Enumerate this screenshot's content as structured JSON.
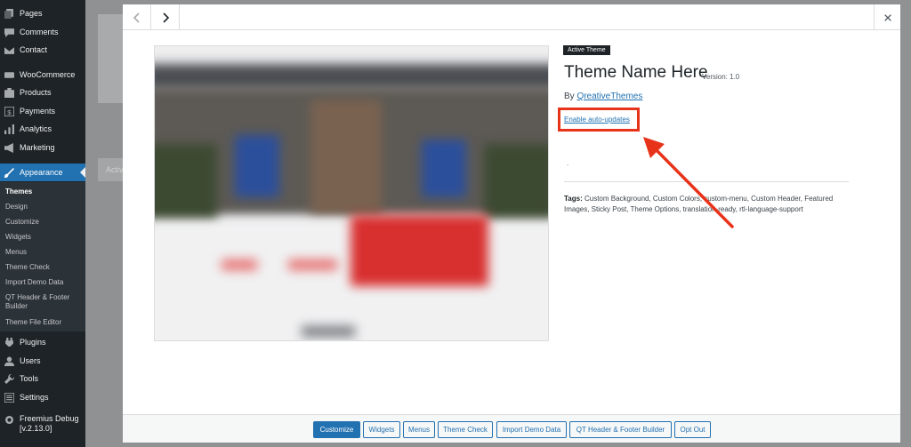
{
  "sidebar": {
    "items": [
      {
        "label": "Pages",
        "icon": "pages-icon"
      },
      {
        "label": "Comments",
        "icon": "comments-icon"
      },
      {
        "label": "Contact",
        "icon": "mail-icon"
      },
      {
        "label": "WooCommerce",
        "icon": "woocommerce-icon"
      },
      {
        "label": "Products",
        "icon": "products-icon"
      },
      {
        "label": "Payments",
        "icon": "payments-icon"
      },
      {
        "label": "Analytics",
        "icon": "analytics-icon"
      },
      {
        "label": "Marketing",
        "icon": "megaphone-icon"
      },
      {
        "label": "Appearance",
        "icon": "brush-icon"
      },
      {
        "label": "Plugins",
        "icon": "plugin-icon"
      },
      {
        "label": "Users",
        "icon": "users-icon"
      },
      {
        "label": "Tools",
        "icon": "tools-icon"
      },
      {
        "label": "Settings",
        "icon": "settings-icon"
      },
      {
        "label": "Freemius Debug [v.2.13.0]",
        "icon": "gear-icon"
      }
    ],
    "submenu": [
      "Themes",
      "Design",
      "Customize",
      "Widgets",
      "Menus",
      "Theme Check",
      "Import Demo Data",
      "QT Header & Footer Builder",
      "Theme File Editor"
    ],
    "active_color": "#2271b1"
  },
  "modal": {
    "badge": "Active Theme",
    "theme_name": "Theme Name Here",
    "version": "Version: 1.0",
    "author_prefix": "By",
    "author_name": "QreativeThemes",
    "auto_update_link": "Enable auto-updates",
    "description": ".",
    "tags_label": "Tags:",
    "tags_text": "Custom Background, Custom Colors, custom-menu, Custom Header, Featured Images, Sticky Post, Theme Options, translation-ready, rtl-language-support",
    "highlight_color": "#e8331b"
  },
  "background": {
    "active_label": "Activ"
  },
  "footer": {
    "buttons": [
      "Customize",
      "Widgets",
      "Menus",
      "Theme Check",
      "Import Demo Data",
      "QT Header & Footer Builder",
      "Opt Out"
    ]
  }
}
